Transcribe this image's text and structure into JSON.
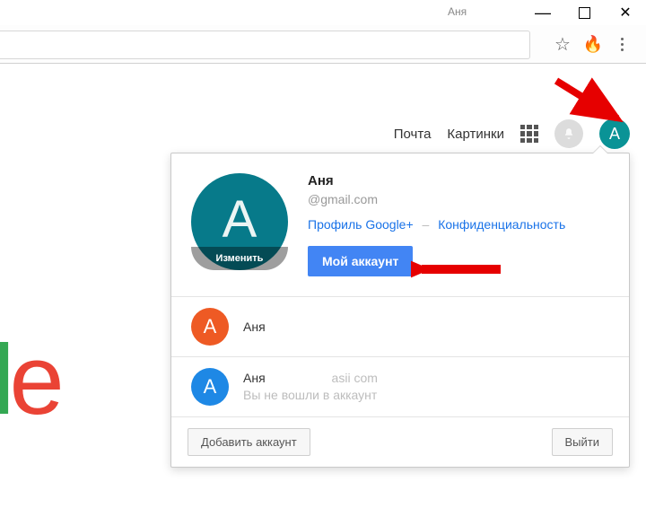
{
  "window": {
    "title": "Аня"
  },
  "header": {
    "mail": "Почта",
    "images": "Картинки",
    "avatar_letter": "А"
  },
  "logo_fragment": {
    "l": "l",
    "e": "e"
  },
  "popup": {
    "main": {
      "avatar_letter": "А",
      "edit_label": "Изменить",
      "name": "Аня",
      "email": "@gmail.com",
      "gplus": "Профиль Google+",
      "privacy": "Конфиденциальность",
      "dash": "–",
      "my_account": "Мой аккаунт"
    },
    "others": [
      {
        "letter": "А",
        "name": "Аня",
        "sub": ""
      },
      {
        "letter": "А",
        "name": "Аня",
        "sub_email": "asii com",
        "note": "Вы не вошли в аккаунт"
      }
    ],
    "footer": {
      "add": "Добавить аккаунт",
      "signout": "Выйти"
    }
  }
}
